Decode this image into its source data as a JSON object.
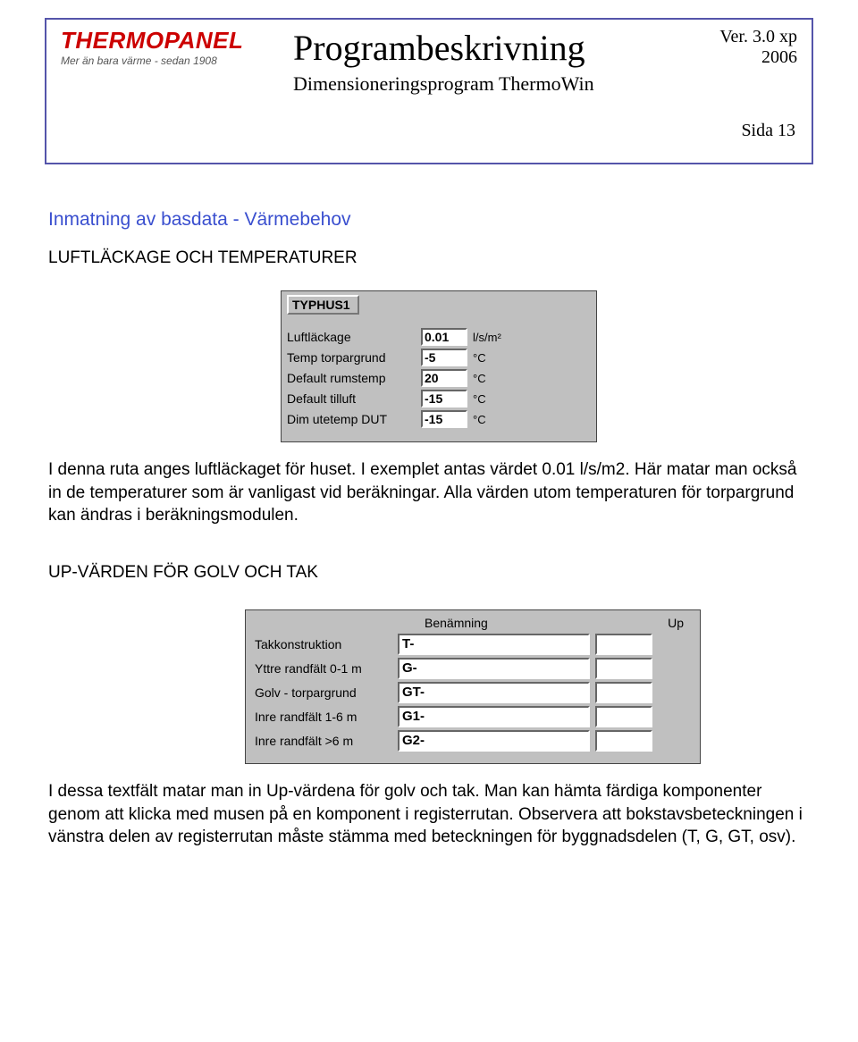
{
  "header": {
    "logo_main": "THERMOPANEL",
    "logo_sub": "Mer än bara värme - sedan 1908",
    "title": "Programbeskrivning",
    "subtitle": "Dimensioneringsprogram ThermoWin",
    "version_line": "Ver. 3.0 xp",
    "year": "2006",
    "page_label": "Sida  13"
  },
  "section1": {
    "heading": "Inmatning av basdata - Värmebehov",
    "subhead": "LUFTLÄCKAGE OCH TEMPERATURER",
    "para1": "I denna ruta anges luftläckaget för huset. I exemplet antas värdet 0.01 l/s/m2. Här matar man också in de temperaturer som är vanligast vid beräkningar. Alla värden utom temperaturen för torpargrund kan ändras i beräkningsmodulen."
  },
  "form1": {
    "typhus": "TYPHUS1",
    "rows": [
      {
        "label": "Luftläckage",
        "value": "0.01",
        "unit": "l/s/m²"
      },
      {
        "label": "Temp torpargrund",
        "value": "-5",
        "unit": "°C"
      },
      {
        "label": "Default rumstemp",
        "value": "20",
        "unit": "°C"
      },
      {
        "label": "Default tilluft",
        "value": "-15",
        "unit": "°C"
      },
      {
        "label": "Dim utetemp DUT",
        "value": "-15",
        "unit": "°C"
      }
    ]
  },
  "section2": {
    "subhead": "UP-VÄRDEN FÖR GOLV OCH TAK",
    "para1": "I dessa textfält matar man in Up-värdena för golv och tak. Man kan hämta färdiga komponenter genom att klicka med musen på en komponent i registerrutan. Observera att bokstavsbeteckningen i vänstra delen av registerrutan måste stämma med beteckningen för byggnadsdelen (T, G, GT, osv)."
  },
  "form2": {
    "col_ben": "Benämning",
    "col_up": "Up",
    "rows": [
      {
        "label": "Takkonstruktion",
        "ben": "T-",
        "up": ""
      },
      {
        "label": "Yttre randfält  0-1 m",
        "ben": "G-",
        "up": ""
      },
      {
        "label": "Golv - torpargrund",
        "ben": "GT-",
        "up": ""
      },
      {
        "label": "Inre randfält  1-6 m",
        "ben": "G1-",
        "up": ""
      },
      {
        "label": "Inre randfält  >6 m",
        "ben": "G2-",
        "up": ""
      }
    ]
  }
}
